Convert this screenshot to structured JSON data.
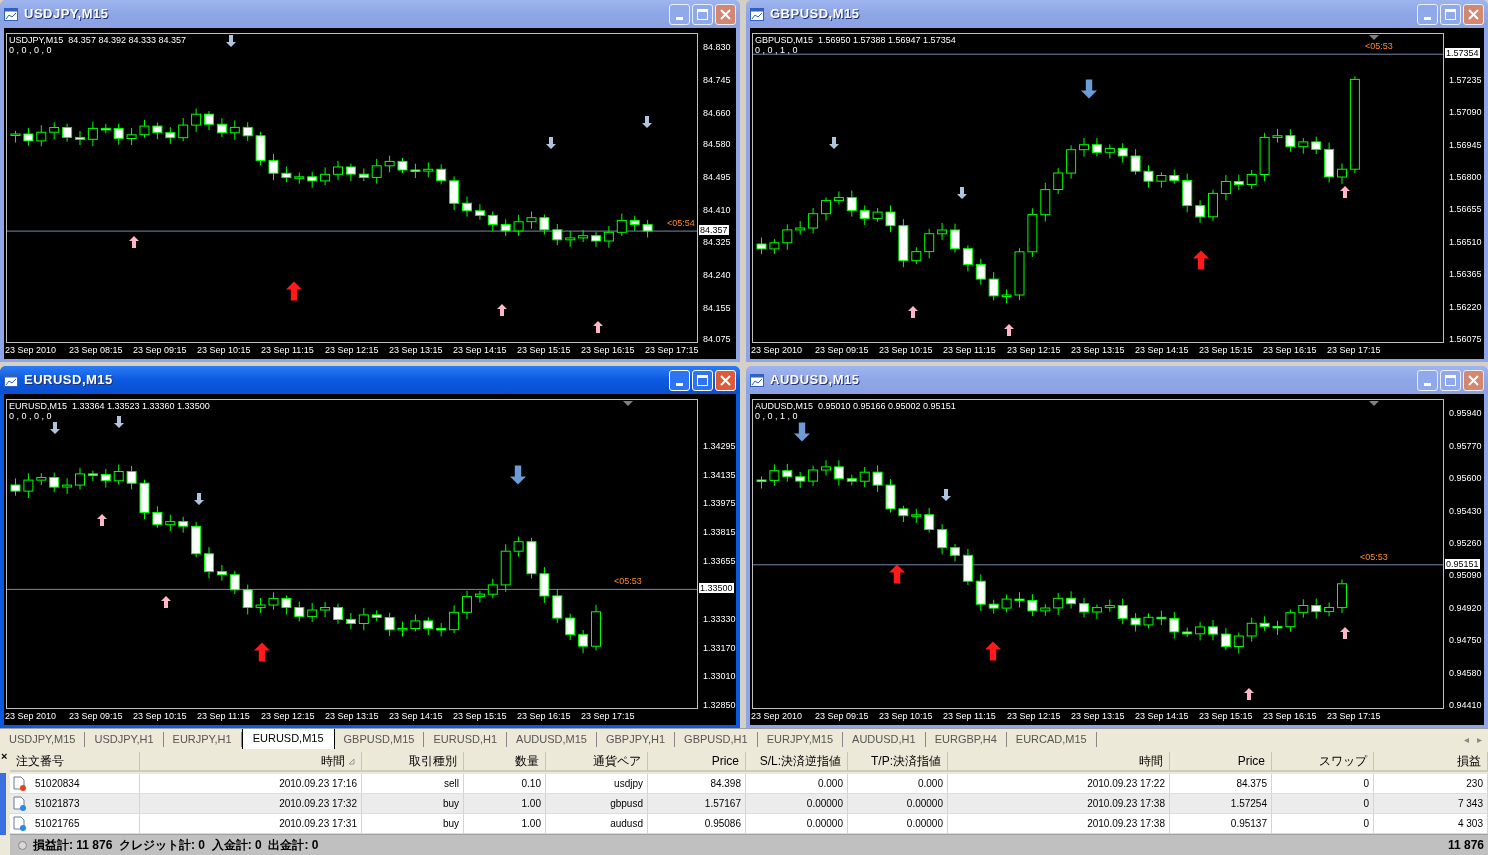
{
  "charts": [
    {
      "title": "USDJPY,M15",
      "active": false,
      "header": "USDJPY,M15  84.357 84.392 84.333 84.357",
      "indicator": "0 , 0 , 0 , 0",
      "countdown": "<05:54",
      "price_labels": [
        {
          "text": "84.830",
          "kind": "tick"
        },
        {
          "text": "84.745",
          "kind": "tick"
        },
        {
          "text": "84.660",
          "kind": "tick"
        },
        {
          "text": "84.580",
          "kind": "tick"
        },
        {
          "text": "84.495",
          "kind": "tick"
        },
        {
          "text": "84.410",
          "kind": "tick"
        },
        {
          "text": "84.357",
          "kind": "current"
        },
        {
          "text": "84.325",
          "kind": "tick"
        },
        {
          "text": "84.240",
          "kind": "tick"
        },
        {
          "text": "84.155",
          "kind": "tick"
        },
        {
          "text": "84.075",
          "kind": "tick"
        }
      ],
      "time_labels": [
        "23 Sep 2010",
        "23 Sep 08:15",
        "23 Sep 09:15",
        "23 Sep 10:15",
        "23 Sep 11:15",
        "23 Sep 12:15",
        "23 Sep 13:15",
        "23 Sep 14:15",
        "23 Sep 15:15",
        "23 Sep 16:15",
        "23 Sep 17:15"
      ]
    },
    {
      "title": "GBPUSD,M15",
      "active": false,
      "header": "GBPUSD,M15  1.56950 1.57388 1.56947 1.57354",
      "indicator": "0 , 0 , 1 , 0",
      "countdown": "<05:53",
      "price_labels": [
        {
          "text": "1.57354",
          "kind": "current"
        },
        {
          "text": "1.57235",
          "kind": "tick"
        },
        {
          "text": "1.57090",
          "kind": "tick"
        },
        {
          "text": "1.56945",
          "kind": "tick"
        },
        {
          "text": "1.56800",
          "kind": "tick"
        },
        {
          "text": "1.56655",
          "kind": "tick"
        },
        {
          "text": "1.56510",
          "kind": "tick"
        },
        {
          "text": "1.56365",
          "kind": "tick"
        },
        {
          "text": "1.56220",
          "kind": "tick"
        },
        {
          "text": "1.56075",
          "kind": "tick"
        }
      ],
      "time_labels": [
        "23 Sep 2010",
        "23 Sep 09:15",
        "23 Sep 10:15",
        "23 Sep 11:15",
        "23 Sep 12:15",
        "23 Sep 13:15",
        "23 Sep 14:15",
        "23 Sep 15:15",
        "23 Sep 16:15",
        "23 Sep 17:15"
      ]
    },
    {
      "title": "EURUSD,M15",
      "active": true,
      "header": "EURUSD,M15  1.33364 1.33523 1.33360 1.33500",
      "indicator": "0 , 0 , 0 , 0",
      "countdown": "<05:53",
      "price_labels": [
        {
          "text": "1.34295",
          "kind": "tick"
        },
        {
          "text": "1.34135",
          "kind": "tick"
        },
        {
          "text": "1.33975",
          "kind": "tick"
        },
        {
          "text": "1.33815",
          "kind": "tick"
        },
        {
          "text": "1.33655",
          "kind": "tick"
        },
        {
          "text": "1.33500",
          "kind": "current"
        },
        {
          "text": "1.33330",
          "kind": "tick"
        },
        {
          "text": "1.33170",
          "kind": "tick"
        },
        {
          "text": "1.33010",
          "kind": "tick"
        },
        {
          "text": "1.32850",
          "kind": "tick"
        }
      ],
      "time_labels": [
        "23 Sep 2010",
        "23 Sep 09:15",
        "23 Sep 10:15",
        "23 Sep 11:15",
        "23 Sep 12:15",
        "23 Sep 13:15",
        "23 Sep 14:15",
        "23 Sep 15:15",
        "23 Sep 16:15",
        "23 Sep 17:15"
      ]
    },
    {
      "title": "AUDUSD,M15",
      "active": false,
      "header": "AUDUSD,M15  0.95010 0.95166 0.95002 0.95151",
      "indicator": "0 , 0 , 1 , 0",
      "countdown": "<05:53",
      "price_labels": [
        {
          "text": "0.95940",
          "kind": "tick"
        },
        {
          "text": "0.95770",
          "kind": "tick"
        },
        {
          "text": "0.95600",
          "kind": "tick"
        },
        {
          "text": "0.95430",
          "kind": "tick"
        },
        {
          "text": "0.95260",
          "kind": "tick"
        },
        {
          "text": "0.95151",
          "kind": "current"
        },
        {
          "text": "0.95090",
          "kind": "tick"
        },
        {
          "text": "0.94920",
          "kind": "tick"
        },
        {
          "text": "0.94750",
          "kind": "tick"
        },
        {
          "text": "0.94580",
          "kind": "tick"
        },
        {
          "text": "0.94410",
          "kind": "tick"
        }
      ],
      "time_labels": [
        "23 Sep 2010",
        "23 Sep 09:15",
        "23 Sep 10:15",
        "23 Sep 11:15",
        "23 Sep 12:15",
        "23 Sep 13:15",
        "23 Sep 14:15",
        "23 Sep 15:15",
        "23 Sep 16:15",
        "23 Sep 17:15"
      ]
    }
  ],
  "tabs": [
    {
      "label": "USDJPY,M15",
      "selected": false
    },
    {
      "label": "USDJPY,H1",
      "selected": false
    },
    {
      "label": "EURJPY,H1",
      "selected": false
    },
    {
      "label": "EURUSD,M15",
      "selected": true
    },
    {
      "label": "GBPUSD,M15",
      "selected": false
    },
    {
      "label": "EURUSD,H1",
      "selected": false
    },
    {
      "label": "AUDUSD,M15",
      "selected": false
    },
    {
      "label": "GBPJPY,H1",
      "selected": false
    },
    {
      "label": "GBPUSD,H1",
      "selected": false
    },
    {
      "label": "EURJPY,M15",
      "selected": false
    },
    {
      "label": "AUDUSD,H1",
      "selected": false
    },
    {
      "label": "EURGBP,H4",
      "selected": false
    },
    {
      "label": "EURCAD,M15",
      "selected": false
    }
  ],
  "tab_scroll": [
    "◂",
    "▸"
  ],
  "terminal": {
    "close": "×",
    "columns": [
      {
        "label": "注文番号",
        "sorted": false
      },
      {
        "label": "時間",
        "sorted": true
      },
      {
        "label": "取引種別",
        "sorted": false
      },
      {
        "label": "数量",
        "sorted": false
      },
      {
        "label": "通貨ペア",
        "sorted": false
      },
      {
        "label": "Price",
        "sorted": false
      },
      {
        "label": "S/L:決済逆指値",
        "sorted": false
      },
      {
        "label": "T/P:決済指値",
        "sorted": false
      },
      {
        "label": "時間",
        "sorted": false
      },
      {
        "label": "Price",
        "sorted": false
      },
      {
        "label": "スワップ",
        "sorted": false
      },
      {
        "label": "損益",
        "sorted": false
      }
    ],
    "rows": [
      {
        "kind": "sell",
        "cells": [
          "51020834",
          "2010.09.23 17:16",
          "sell",
          "0.10",
          "usdjpy",
          "84.398",
          "0.000",
          "0.000",
          "2010.09.23 17:22",
          "84.375",
          "0",
          "230"
        ]
      },
      {
        "kind": "buy",
        "cells": [
          "51021873",
          "2010.09.23 17:32",
          "buy",
          "1.00",
          "gbpusd",
          "1.57167",
          "0.00000",
          "0.00000",
          "2010.09.23 17:38",
          "1.57254",
          "0",
          "7 343"
        ]
      },
      {
        "kind": "buy",
        "cells": [
          "51021765",
          "2010.09.23 17:31",
          "buy",
          "1.00",
          "audusd",
          "0.95086",
          "0.00000",
          "0.00000",
          "2010.09.23 17:38",
          "0.95137",
          "0",
          "4 303"
        ]
      }
    ],
    "summary": "損益計: 11 876  クレジット計: 0  入金計: 0  出金計: 0",
    "total": "11 876"
  }
}
